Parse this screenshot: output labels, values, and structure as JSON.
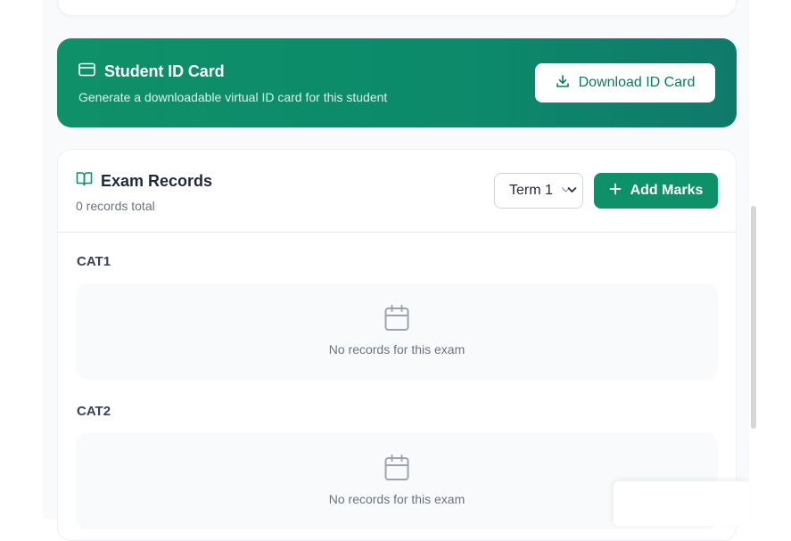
{
  "id_card": {
    "title": "Student ID Card",
    "subtitle": "Generate a downloadable virtual ID card for this student",
    "download_label": "Download ID Card"
  },
  "exam_records": {
    "title": "Exam Records",
    "count_text": "0 records total",
    "term_selected": "Term 1",
    "add_label": "Add Marks",
    "sections": [
      {
        "name": "CAT1",
        "empty_message": "No records for this exam"
      },
      {
        "name": "CAT2",
        "empty_message": "No records for this exam"
      }
    ]
  },
  "colors": {
    "accent": "#0e9068",
    "banner_gradient_end": "#0f7a6a"
  },
  "icons": {
    "id_card": "credit-card-icon",
    "download": "download-icon",
    "exam": "open-book-icon",
    "add": "plus-icon",
    "empty": "calendar-icon",
    "select": "chevron-down-icon"
  }
}
